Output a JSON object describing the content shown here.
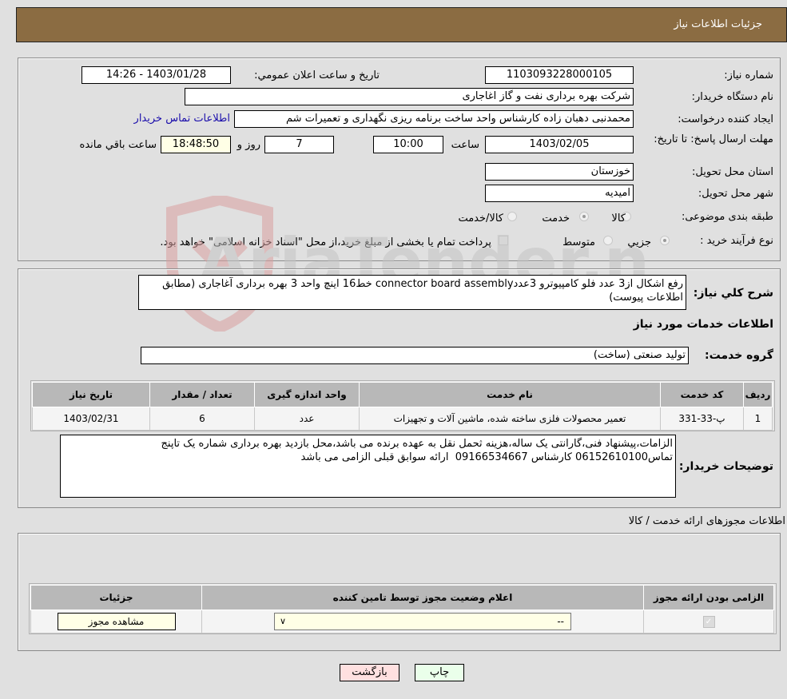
{
  "header": {
    "title": "جزئیات اطلاعات نیاز"
  },
  "info": {
    "need_number_label": "شماره نیاز:",
    "need_number": "1103093228000105",
    "announce_label": "تاریخ و ساعت اعلان عمومي:",
    "announce_value": "1403/01/28 - 14:26",
    "buyer_org_label": "نام دستگاه خریدار:",
    "buyer_org": "شرکت بهره برداری نفت و گاز اغاجاری",
    "requester_label": "ایجاد کننده درخواست:",
    "requester": "محمدنبی دهبان زاده کارشناس واحد ساخت برنامه ریزی نگهداری  و تعمیرات شم",
    "contact_link": "اطلاعات تماس خریدار",
    "deadline_label": "مهلت ارسال پاسخ: تا تاریخ:",
    "deadline_date": "1403/02/05",
    "time_label": "ساعت",
    "deadline_time": "10:00",
    "days": "7",
    "days_label": "روز و",
    "remaining": "18:48:50",
    "remaining_label": "ساعت باقي مانده",
    "province_label": "استان محل تحویل:",
    "province": "خوزستان",
    "city_label": "شهر محل تحویل:",
    "city": "امیدیه",
    "category_label": "طبقه بندی موضوعی:",
    "category_options": [
      {
        "label": "کالا",
        "selected": false
      },
      {
        "label": "خدمت",
        "selected": true
      },
      {
        "label": "کالا/خدمت",
        "selected": false
      }
    ],
    "process_label": "نوع فرآیند خرید :",
    "process_options": [
      {
        "label": "جزيي",
        "selected": true
      },
      {
        "label": "متوسط",
        "selected": false
      }
    ],
    "treasury_checkbox_label": "پرداخت تمام یا بخشی از مبلغ خرید،از محل \"اسناد خزانه اسلامی\" خواهد بود.",
    "treasury_checked": false
  },
  "description": {
    "label": "شرح کلي نیاز:",
    "value": "رفع اشکال از3 عدد فلو کامپیوترو 3عددconnector board assembly خط16 اینچ واحد 3 بهره برداری آغاجاری (مطابق اطلاعات پیوست)"
  },
  "services": {
    "title": "اطلاعات خدمات مورد نیاز",
    "group_label": "گروه خدمت:",
    "group_value": "تولید صنعتی (ساخت)",
    "columns": [
      "ردیف",
      "کد خدمت",
      "نام خدمت",
      "واحد اندازه گیری",
      "تعداد / مقدار",
      "تاریخ نیاز"
    ],
    "rows": [
      [
        "1",
        "پ-33-331",
        "تعمیر محصولات فلزی ساخته شده، ماشین آلات و تجهیزات",
        "عدد",
        "6",
        "1403/02/31"
      ]
    ]
  },
  "buyer_notes": {
    "label": "توضیحات خریدار:",
    "value": "الزامات،پیشنهاد فنی،گارانتی یک ساله،هزینه ثحمل نقل به عهده برنده می باشد،محل بازدید بهره برداری شماره یک تاپنج تماس06152610100 کارشناس 09166534667  ارائه سوابق قبلی الزامی می باشد"
  },
  "permits": {
    "title": "اطلاعات مجوزهای ارائه خدمت / کالا",
    "columns": [
      "الزامی بودن ارائه مجوز",
      "اعلام وضعیت مجوز توسط تامین کننده",
      "جزئیات"
    ],
    "rows": [
      {
        "required_checked": true,
        "status_selected": "--",
        "details_button": "مشاهده مجوز"
      }
    ]
  },
  "actions": {
    "print": "چاپ",
    "back": "بازگشت"
  },
  "watermark": {
    "text": "AriaTender.neT"
  },
  "colors": {
    "header_bg": "#8b6c42",
    "print_bg": "#eaffea",
    "back_bg": "#ffe0e0",
    "link": "#1a0dab"
  }
}
